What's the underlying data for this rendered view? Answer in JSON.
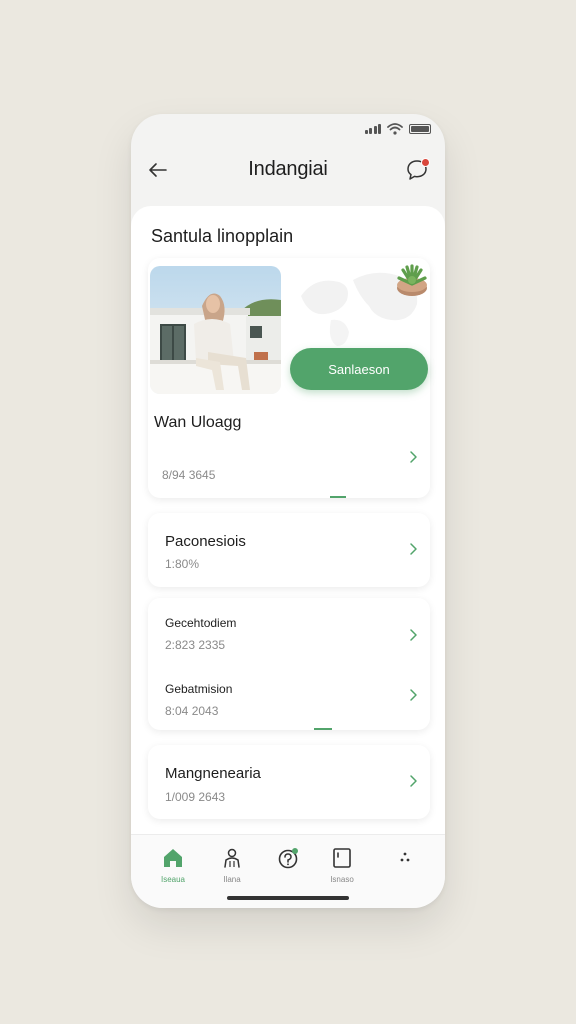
{
  "status_bar": {
    "icons": [
      "signal-icon",
      "wifi-icon",
      "battery-icon"
    ]
  },
  "header": {
    "title": "Indangiai",
    "back_icon": "arrow-left-icon",
    "notification_icon": "chat-bubble-icon"
  },
  "section": {
    "title": "Santula linopplain"
  },
  "hero": {
    "button_label": "Sanlaeson",
    "name": "Wan Uloagg",
    "sub": "8/94 3645"
  },
  "list": [
    {
      "title": "Paconesiois",
      "sub": "1:80%"
    },
    {
      "title": "Gecehtodiem",
      "sub": "2:823 2335"
    },
    {
      "title": "Gebatmision",
      "sub": "8:04 2043"
    },
    {
      "title": "Mangnenearia",
      "sub": "1/009 2643"
    }
  ],
  "nav": [
    {
      "label": "Iseaua",
      "icon": "home-icon",
      "active": true
    },
    {
      "label": "Ilana",
      "icon": "person-icon",
      "active": false
    },
    {
      "label": "",
      "icon": "help-badge-icon",
      "active": false
    },
    {
      "label": "Isnaso",
      "icon": "document-icon",
      "active": false
    },
    {
      "label": "",
      "icon": "more-icon",
      "active": false
    }
  ],
  "colors": {
    "accent": "#52a46b",
    "badge": "#d9463b",
    "background": "#ebe8e0"
  }
}
